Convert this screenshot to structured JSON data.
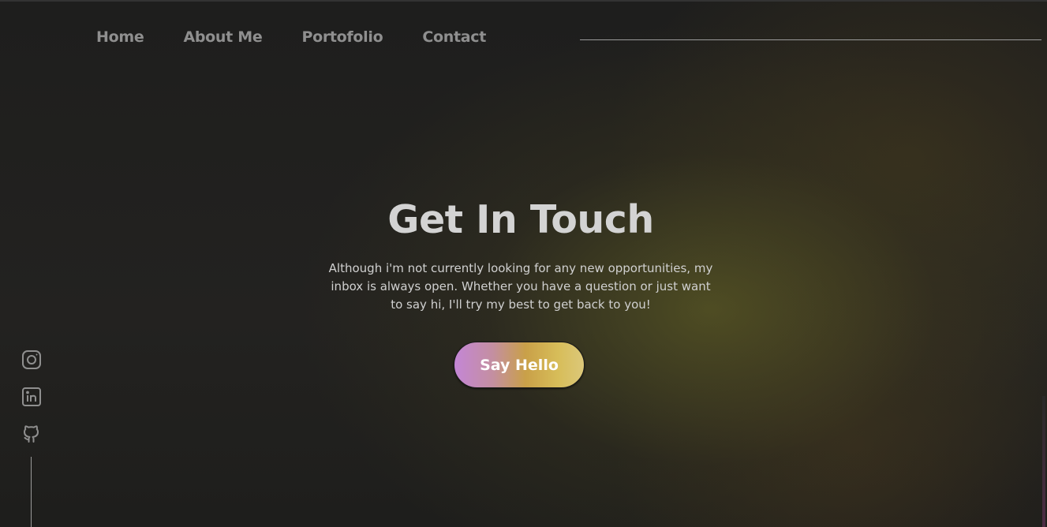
{
  "nav": {
    "items": [
      {
        "label": "Home"
      },
      {
        "label": "About Me"
      },
      {
        "label": "Portofolio"
      },
      {
        "label": "Contact"
      }
    ]
  },
  "hero": {
    "title": "Get In Touch",
    "description": "Although i'm not currently looking for any new opportunities, my inbox is always open. Whether you have a question or just want to say hi, I'll try my best to get back to you!",
    "button_label": "Say Hello"
  },
  "social": {
    "icons": [
      "instagram-icon",
      "linkedin-icon",
      "github-icon"
    ]
  },
  "colors": {
    "background": "#1b1b1b",
    "nav_text": "#8f8f8f",
    "title_text": "#d3d3d3",
    "button_gradient_start": "#c486d6",
    "button_gradient_end": "#dcc87a"
  }
}
